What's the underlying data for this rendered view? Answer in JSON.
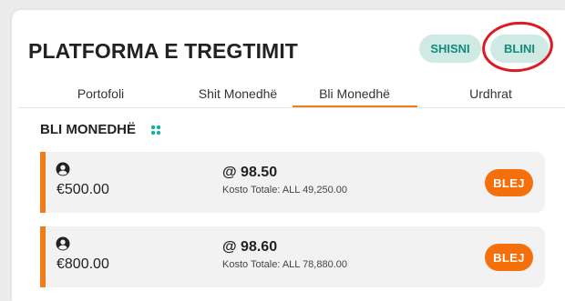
{
  "header": {
    "title": "PLATFORMA E TREGTIMIT",
    "sell_label": "SHISNI",
    "buy_label": "BLINI"
  },
  "tabs": [
    {
      "label": "Portofoli"
    },
    {
      "label": "Shit Monedhë"
    },
    {
      "label": "Bli Monedhë",
      "active": true
    },
    {
      "label": "Urdhrat"
    }
  ],
  "section": {
    "title": "BLI MONEDHË",
    "icon": "dots-grid-icon"
  },
  "orders": [
    {
      "amount": "€500.00",
      "price": "@ 98.50",
      "total_cost": "Kosto Totale: ALL 49,250.00",
      "button_label": "BLEJ"
    },
    {
      "amount": "€800.00",
      "price": "@ 98.60",
      "total_cost": "Kosto Totale: ALL 78,880.00",
      "button_label": "BLEJ"
    }
  ],
  "colors": {
    "accent": "#f07d1a",
    "button": "#f5700a",
    "pill_bg": "#cfe9e4",
    "pill_text": "#138a7a",
    "annotation_ring": "#dd1a24"
  }
}
